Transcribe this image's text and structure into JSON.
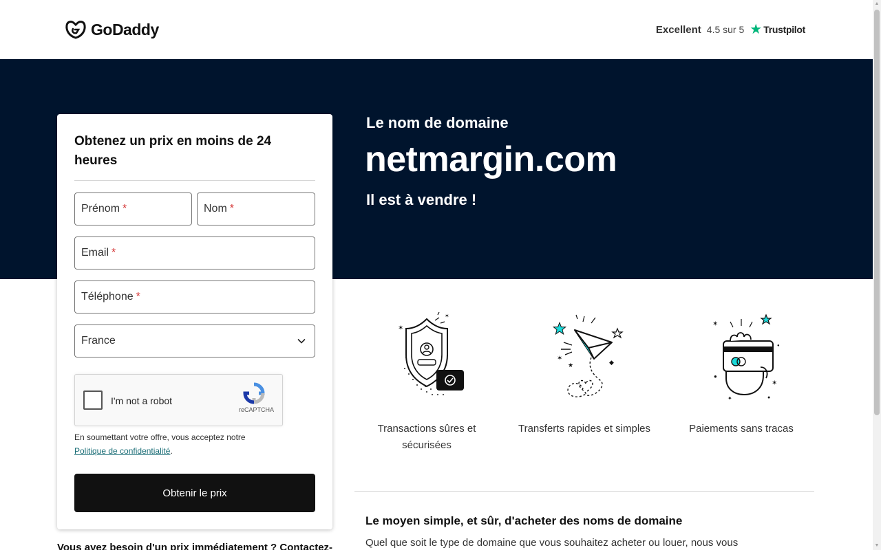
{
  "header": {
    "logo_text": "GoDaddy",
    "trustpilot": {
      "rating_word": "Excellent",
      "score_text": "4.5 sur 5",
      "brand": "Trustpilot",
      "star_color": "#00b67a"
    }
  },
  "hero": {
    "subtitle": "Le nom de domaine",
    "domain": "netmargin.com",
    "sale_text": "Il est à vendre !",
    "background_color": "#00142d"
  },
  "form": {
    "title": "Obtenez un prix en moins de 24 heures",
    "fields": {
      "first_name": "Prénom",
      "last_name": "Nom",
      "email": "Email",
      "phone": "Téléphone",
      "country": "France"
    },
    "required_marker": "*",
    "captcha": {
      "label": "I'm not a robot",
      "brand": "reCAPTCHA"
    },
    "consent_text": "En soumettant votre offre, vous acceptez notre",
    "consent_link": "Politique de confidentialité",
    "consent_end": ".",
    "submit_label": "Obtenir le prix"
  },
  "below_card_text": "Vous avez besoin d'un prix immédiatement ? Contactez-",
  "features": [
    {
      "label": "Transactions sûres et sécurisées",
      "icon": "shield-icon"
    },
    {
      "label": "Transferts rapides et simples",
      "icon": "paper-plane-icon"
    },
    {
      "label": "Paiements sans tracas",
      "icon": "credit-card-hand-icon"
    }
  ],
  "section": {
    "title": "Le moyen simple, et sûr, d'acheter des noms de domaine",
    "text": "Quel que soit le type de domaine que vous souhaitez acheter ou louer, nous vous"
  },
  "colors": {
    "accent_teal": "#1bdbdb",
    "button": "#111111",
    "link": "#1b6e77"
  }
}
